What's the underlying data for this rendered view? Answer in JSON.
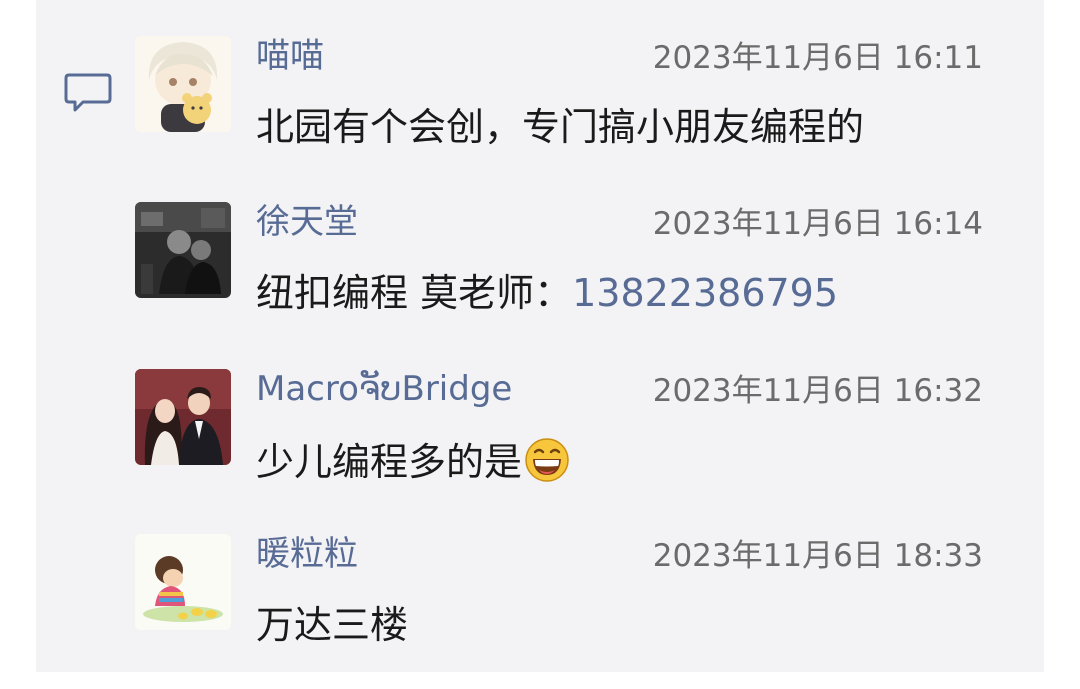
{
  "comments": [
    {
      "username": "喵喵",
      "timestamp": "2023年11月6日 16:11",
      "message": "北园有个会创，专门搞小朋友编程的",
      "avatar_icon": "anime-boy-with-bear-avatar"
    },
    {
      "username": "徐天堂",
      "timestamp": "2023年11月6日 16:14",
      "message_prefix": "纽扣编程 莫老师：",
      "phone": "13822386795",
      "avatar_icon": "dark-photo-avatar"
    },
    {
      "username": "MacroຈັບBridge",
      "timestamp": "2023年11月6日 16:32",
      "message": "少儿编程多的是",
      "emoji_icon": "grinning-face-emoji",
      "avatar_icon": "couple-illustration-avatar"
    },
    {
      "username": "暖粒粒",
      "timestamp": "2023年11月6日 18:33",
      "message": "万达三楼",
      "avatar_icon": "child-cartoon-avatar"
    }
  ],
  "colors": {
    "panel_background": "#f3f3f5",
    "username": "#576b95",
    "link": "#576b95",
    "timestamp": "#6b6b6b",
    "message": "#1a1a1a"
  }
}
